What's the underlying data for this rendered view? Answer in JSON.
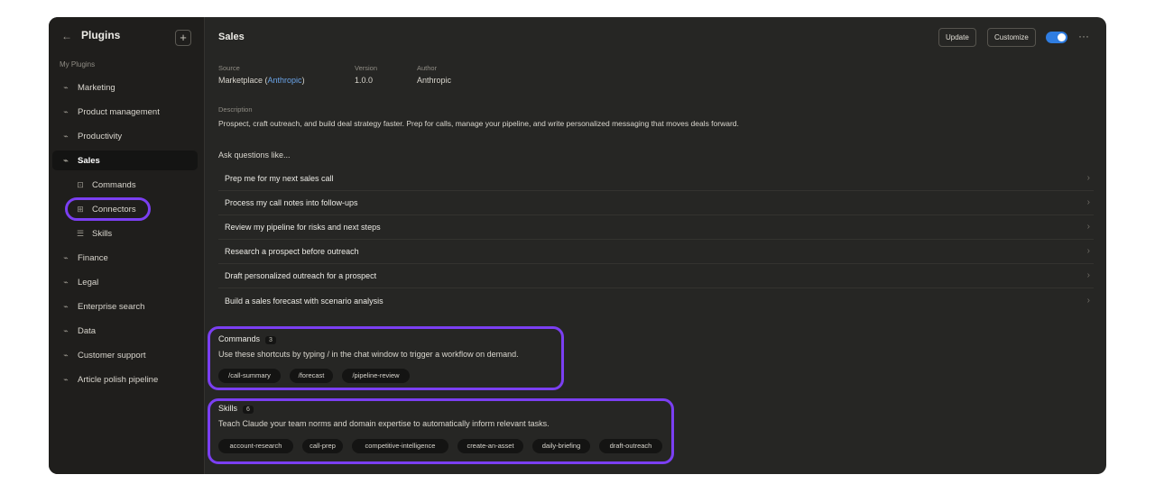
{
  "sidebar": {
    "title": "Plugins",
    "back_icon": "arrow-left-icon",
    "add_icon": "plus-icon",
    "section_label": "My Plugins",
    "items": [
      {
        "label": "Marketing",
        "icon": "plug-icon"
      },
      {
        "label": "Product management",
        "icon": "plug-icon"
      },
      {
        "label": "Productivity",
        "icon": "plug-icon"
      },
      {
        "label": "Sales",
        "icon": "plug-icon",
        "active": true
      },
      {
        "label": "Commands",
        "icon": "command-icon",
        "sub": true
      },
      {
        "label": "Connectors",
        "icon": "connector-icon",
        "sub": true,
        "highlighted": true
      },
      {
        "label": "Skills",
        "icon": "skills-icon",
        "sub": true
      },
      {
        "label": "Finance",
        "icon": "plug-icon"
      },
      {
        "label": "Legal",
        "icon": "plug-icon"
      },
      {
        "label": "Enterprise search",
        "icon": "plug-icon"
      },
      {
        "label": "Data",
        "icon": "plug-icon"
      },
      {
        "label": "Customer support",
        "icon": "plug-icon"
      },
      {
        "label": "Article polish pipeline",
        "icon": "plug-icon"
      }
    ]
  },
  "header": {
    "title": "Sales",
    "update_label": "Update",
    "customize_label": "Customize",
    "toggle_on": true,
    "more_icon": "more-horizontal-icon"
  },
  "meta": {
    "source_label": "Source",
    "source_value_prefix": "Marketplace (",
    "source_link": "Anthropic",
    "source_value_suffix": ")",
    "version_label": "Version",
    "version_value": "1.0.0",
    "author_label": "Author",
    "author_value": "Anthropic"
  },
  "description": {
    "label": "Description",
    "text": "Prospect, craft outreach, and build deal strategy faster. Prep for calls, manage your pipeline, and write personalized messaging that moves deals forward."
  },
  "ask": {
    "label": "Ask questions like...",
    "items": [
      "Prep me for my next sales call",
      "Process my call notes into follow-ups",
      "Review my pipeline for risks and next steps",
      "Research a prospect before outreach",
      "Draft personalized outreach for a prospect",
      "Build a sales forecast with scenario analysis"
    ]
  },
  "commands": {
    "title": "Commands",
    "count": "3",
    "description": "Use these shortcuts by typing / in the chat window to trigger a workflow on demand.",
    "chips": [
      "/call-summary",
      "/forecast",
      "/pipeline-review"
    ]
  },
  "skills": {
    "title": "Skills",
    "count": "6",
    "description": "Teach Claude your team norms and domain expertise to automatically inform relevant tasks.",
    "chips": [
      "account-research",
      "call-prep",
      "competitive-intelligence",
      "create-an-asset",
      "daily-briefing",
      "draft-outreach"
    ]
  },
  "colors": {
    "highlight": "#7b3ff2",
    "link": "#6aa4e8",
    "toggle": "#2f7de1"
  }
}
